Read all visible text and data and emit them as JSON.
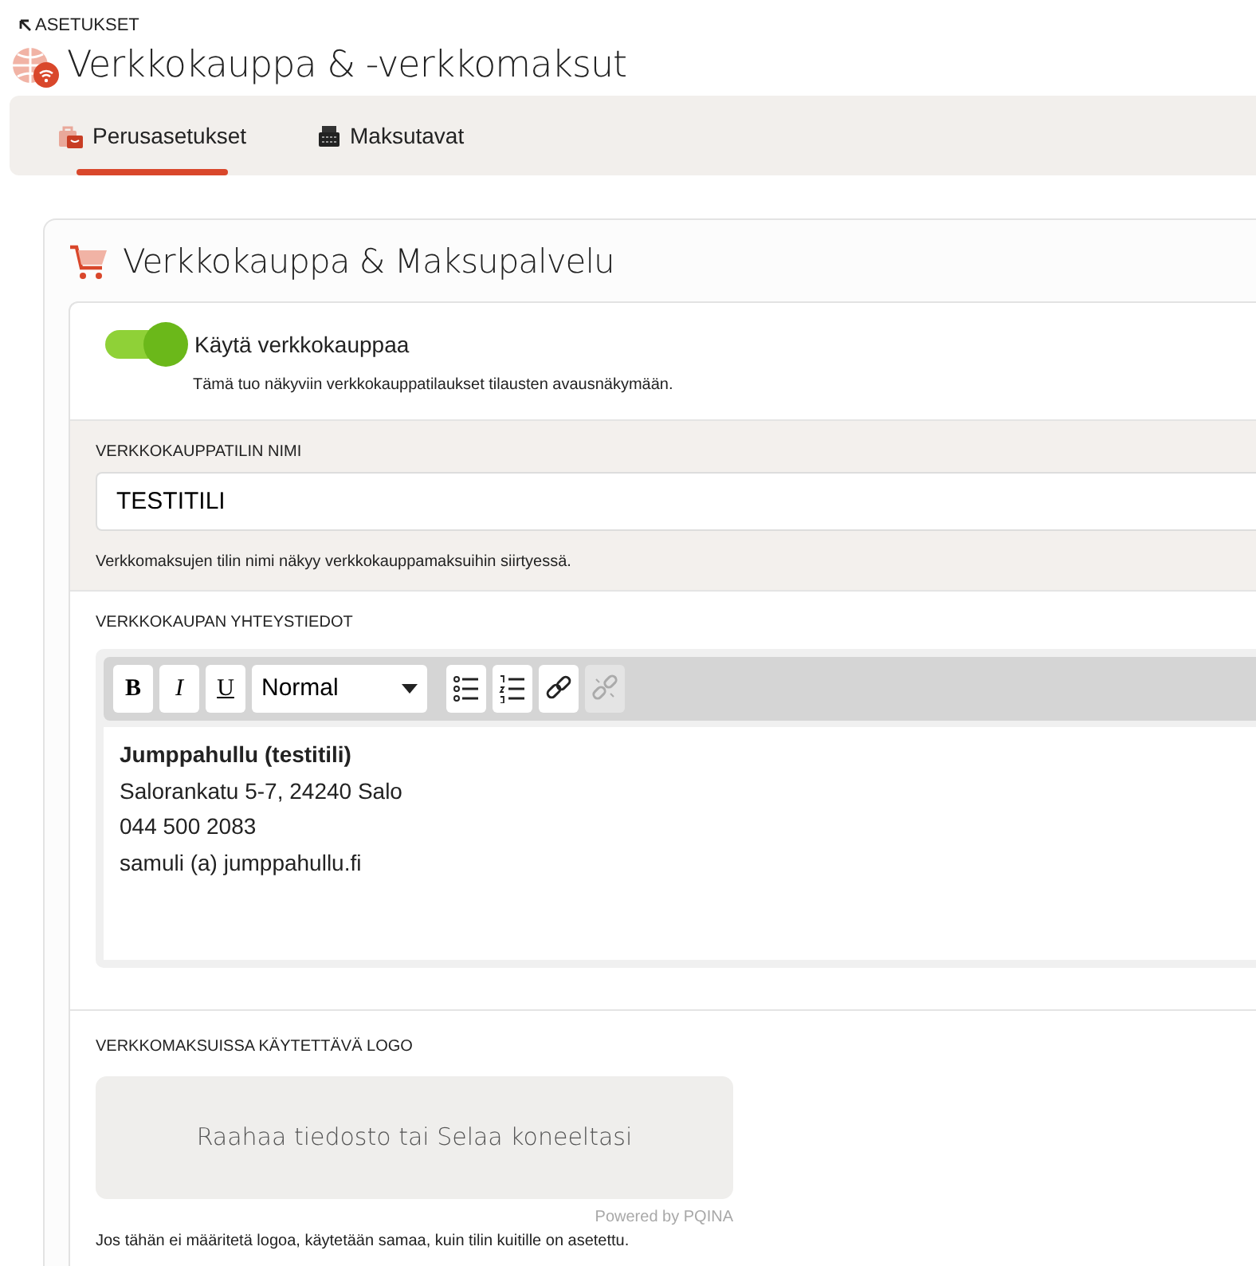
{
  "header": {
    "back_label": "ASETUKSET",
    "title": "Verkkokauppa & -verkkomaksut"
  },
  "tabs": [
    {
      "label": "Perusasetukset",
      "selected": true
    },
    {
      "label": "Maksutavat",
      "selected": false
    }
  ],
  "card": {
    "title": "Verkkokauppa & Maksupalvelu",
    "toggle": {
      "label": "Käytä verkkokauppaa",
      "on": true,
      "description": "Tämä tuo näkyviin verkkokauppatilaukset tilausten avausnäkymään."
    },
    "account_name": {
      "label": "VERKKOKAUPPATILIN NIMI",
      "value": "TESTITILI",
      "help": "Verkkomaksujen tilin nimi näkyy verkkokauppamaksuihin siirtyessä."
    },
    "contact": {
      "label": "VERKKOKAUPAN YHTEYSTIEDOT",
      "toolbar": [
        {
          "kind": "bold",
          "text": "B",
          "disabled": false
        },
        {
          "kind": "italic",
          "text": "I",
          "disabled": false
        },
        {
          "kind": "underline",
          "text": "U",
          "disabled": false
        },
        {
          "kind": "dropdown",
          "text": "Normal",
          "disabled": false
        },
        {
          "kind": "bullets",
          "disabled": false
        },
        {
          "kind": "numbers",
          "disabled": false
        },
        {
          "kind": "link",
          "disabled": false
        },
        {
          "kind": "unlink",
          "disabled": true
        }
      ],
      "lines": [
        {
          "text": "Jumppahullu (testitili)",
          "bold": true
        },
        {
          "text": "Salorankatu 5-7, 24240 Salo",
          "bold": false
        },
        {
          "text": "044 500 2083",
          "bold": false
        },
        {
          "text": "samuli (a) jumppahullu.fi",
          "bold": false
        }
      ]
    },
    "logo": {
      "label": "VERKKOMAKSUISSA KÄYTETTÄVÄ LOGO",
      "dropzone": "Raahaa tiedosto tai Selaa koneeltasi",
      "powered_by": "Powered by PQINA",
      "help": "Jos tähän ei määritetä logoa, käytetään samaa, kuin tilin kuitille on asetettu."
    }
  }
}
